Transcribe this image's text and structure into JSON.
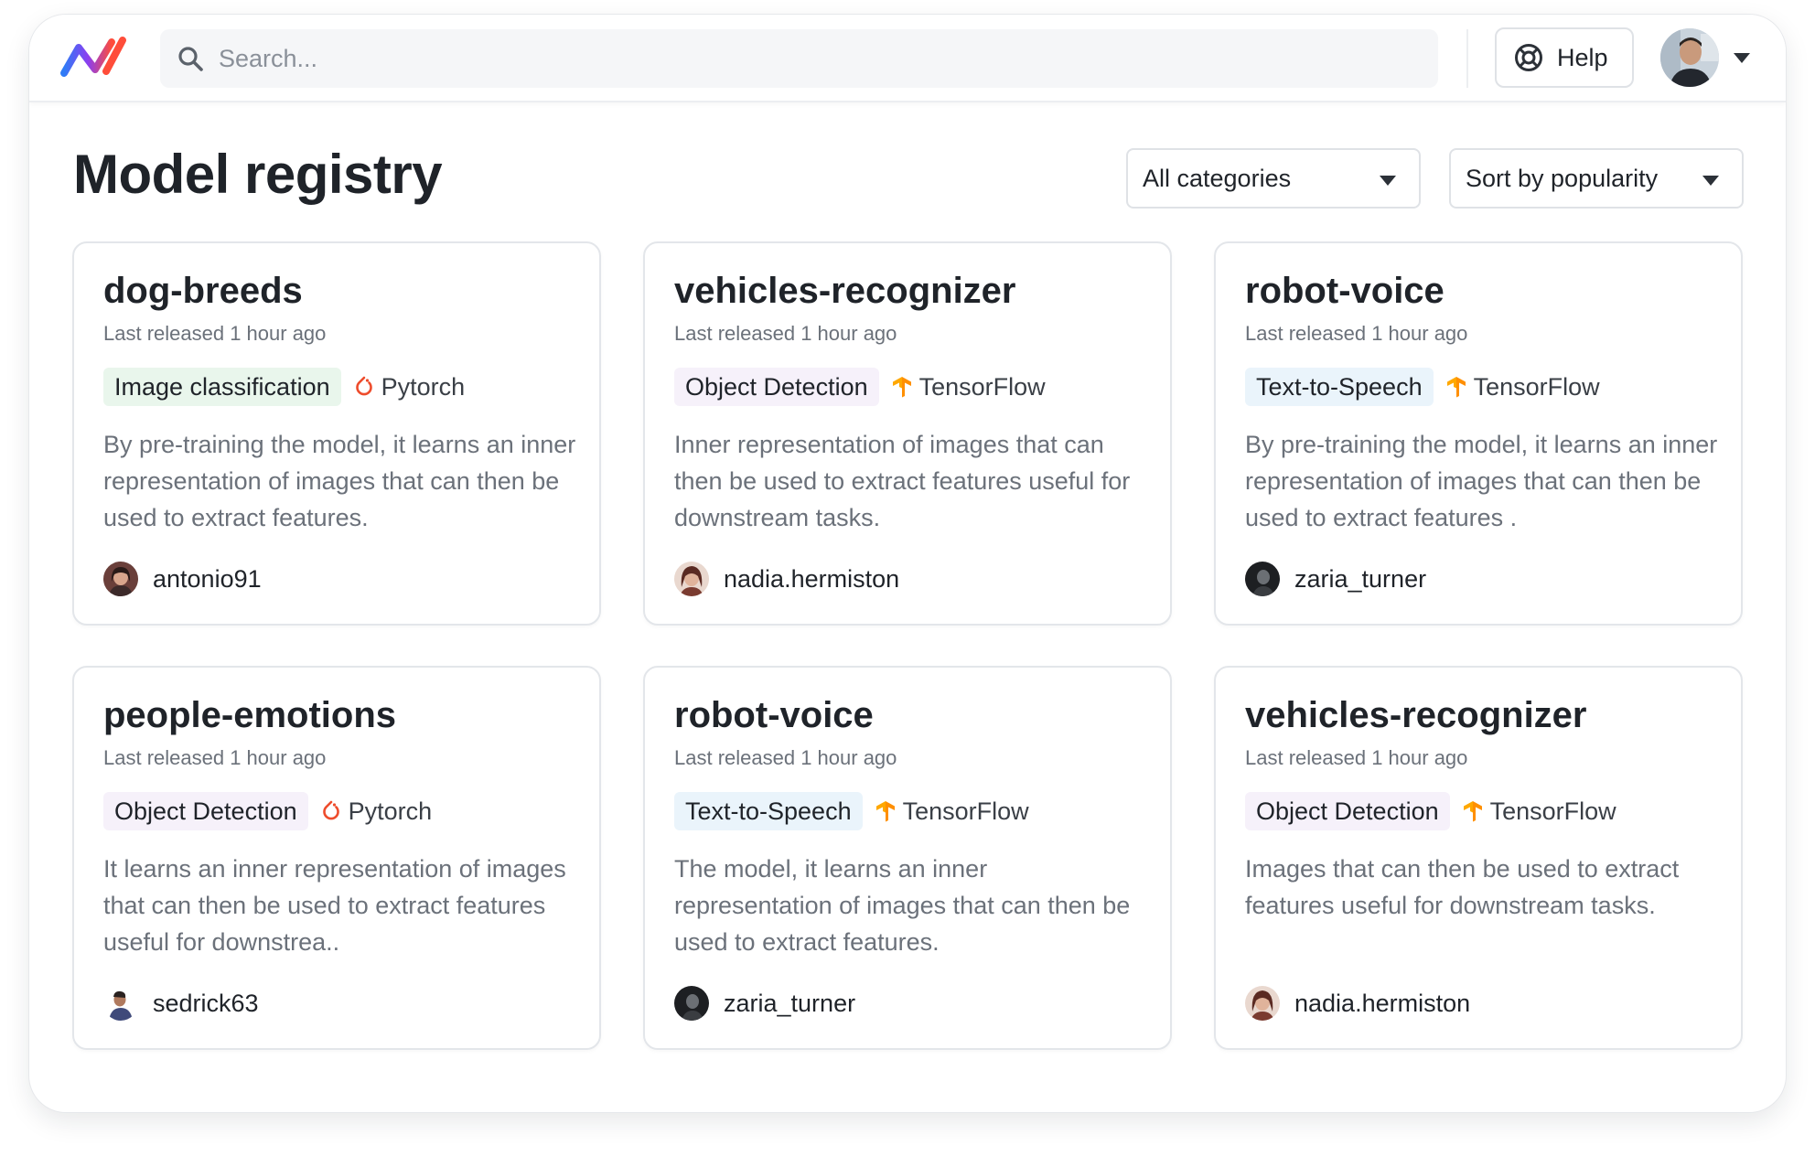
{
  "header": {
    "search_placeholder": "Search...",
    "help_label": "Help"
  },
  "page": {
    "title": "Model registry",
    "category_filter": "All categories",
    "sort_filter": "Sort by popularity"
  },
  "colors": {
    "tag_green_bg": "#e9f6ec",
    "tag_purple_bg": "#f6f1fa",
    "tag_blue_bg": "#eaf4fb",
    "pytorch": "#ee4c2c",
    "tensorflow": "#ff8f00"
  },
  "cards": [
    {
      "name": "dog-breeds",
      "released": "Last released 1 hour ago",
      "tag": "Image classification",
      "framework": "Pytorch",
      "framework_icon": "pytorch-icon",
      "description": "By pre-training the model, it learns an inner representation of images that can then be used to extract features.",
      "author": "antonio91"
    },
    {
      "name": "vehicles-recognizer",
      "released": "Last released 1 hour ago",
      "tag": "Object Detection",
      "framework": "TensorFlow",
      "framework_icon": "tensorflow-icon",
      "description": "Inner representation of images that can then be used to extract features useful for downstream tasks.",
      "author": "nadia.hermiston"
    },
    {
      "name": "robot-voice",
      "released": "Last released 1 hour ago",
      "tag": "Text-to-Speech",
      "framework": "TensorFlow",
      "framework_icon": "tensorflow-icon",
      "description": "By pre-training the model, it learns an inner representation of images that can then be used to extract features .",
      "author": "zaria_turner"
    },
    {
      "name": "people-emotions",
      "released": "Last released 1 hour ago",
      "tag": "Object Detection",
      "framework": "Pytorch",
      "framework_icon": "pytorch-icon",
      "description": "It learns an inner representation of images that can then be used to extract features useful for downstrea..",
      "author": "sedrick63"
    },
    {
      "name": "robot-voice",
      "released": "Last released 1 hour ago",
      "tag": "Text-to-Speech",
      "framework": "TensorFlow",
      "framework_icon": "tensorflow-icon",
      "description": "The model, it learns an inner representation of images that can then be used to extract features.",
      "author": "zaria_turner"
    },
    {
      "name": "vehicles-recognizer",
      "released": "Last released 1 hour ago",
      "tag": "Object Detection",
      "framework": "TensorFlow",
      "framework_icon": "tensorflow-icon",
      "description": "Images that can then be used to extract features useful for downstream tasks.",
      "author": "nadia.hermiston"
    }
  ]
}
